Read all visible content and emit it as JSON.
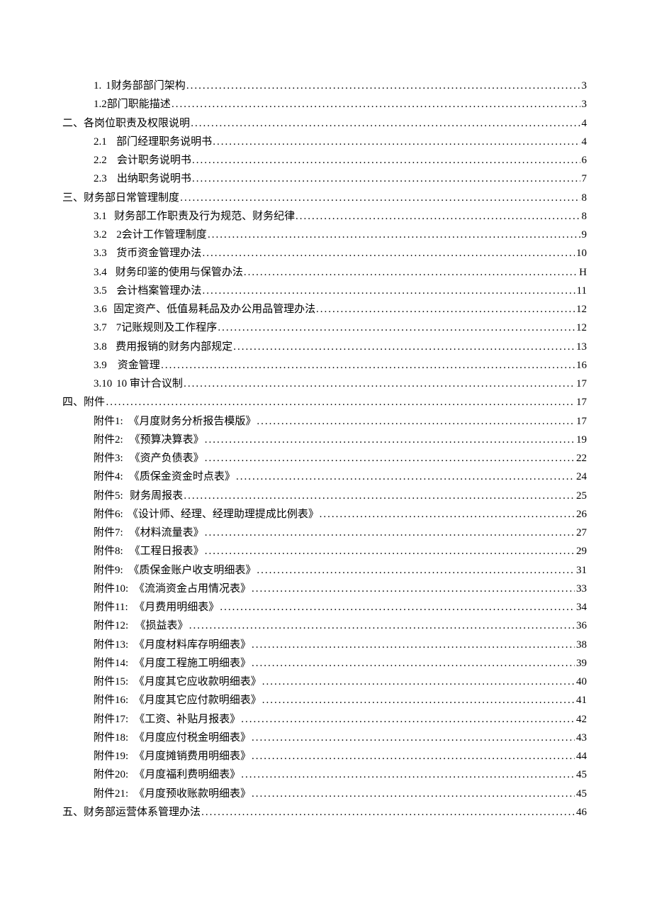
{
  "toc": [
    {
      "indent": "lvl1",
      "num": "1.",
      "gap": "gap-s",
      "title": "1财务部部门架构",
      "page": "3"
    },
    {
      "indent": "lvl1",
      "num": "",
      "gap": "",
      "title": "1.2部门职能描述",
      "page": "3"
    },
    {
      "indent": "lvl0",
      "num": "二、",
      "gap": "",
      "title": "各岗位职责及权限说明",
      "page": "4"
    },
    {
      "indent": "lvl1",
      "num": "2.1",
      "gap": "gap-m",
      "title": "部门经理职务说明书",
      "page": "4"
    },
    {
      "indent": "lvl1",
      "num": "2.2",
      "gap": "gap-m",
      "title": "会计职务说明书",
      "page": "6"
    },
    {
      "indent": "lvl1",
      "num": "2.3",
      "gap": "gap-m",
      "title": "出纳职务说明书",
      "page": "7"
    },
    {
      "indent": "lvl0",
      "num": "三、",
      "gap": "",
      "title": "财务部日常管理制度",
      "page": "8"
    },
    {
      "indent": "lvl1",
      "num": "3.1",
      "gap": "gap-m",
      "title": "财务部工作职责及行为规范、财务纪律",
      "page": "8"
    },
    {
      "indent": "lvl1",
      "num": "3.2",
      "gap": "gap-m",
      "title": "2会计工作管理制度",
      "page": "9"
    },
    {
      "indent": "lvl1",
      "num": "3.3",
      "gap": "gap-m",
      "title": "货币资金管理办法",
      "page": "10"
    },
    {
      "indent": "lvl1",
      "num": "3.4",
      "gap": "gap-m",
      "title": "财务印鉴的使用与保管办法",
      "page": "H"
    },
    {
      "indent": "lvl1",
      "num": "3.5",
      "gap": "gap-m",
      "title": "会计档案管理办法",
      "page": "11"
    },
    {
      "indent": "lvl1",
      "num": "3.6",
      "gap": "gap-m",
      "title": "固定资产、低值易耗品及办公用品管理办法",
      "page": "12"
    },
    {
      "indent": "lvl1",
      "num": "3.7",
      "gap": "gap-m",
      "title": "7记账规则及工作程序",
      "page": "12"
    },
    {
      "indent": "lvl1",
      "num": "3.8",
      "gap": "gap-m",
      "title": "费用报销的财务内部规定",
      "page": "13"
    },
    {
      "indent": "lvl1",
      "num": "3.9",
      "gap": "gap-m",
      "title": "资金管理",
      "page": "16"
    },
    {
      "indent": "lvl1",
      "num": "3.10",
      "gap": "gap-s",
      "title": "10 审计合议制",
      "page": "17"
    },
    {
      "indent": "lvl0",
      "num": "四、",
      "gap": "",
      "title": "附件",
      "page": "17"
    },
    {
      "indent": "lvl1",
      "num": "附件1:",
      "gap": "gap-l",
      "title": "《月度财务分析报告模版》",
      "page": "17"
    },
    {
      "indent": "lvl1",
      "num": "附件2:",
      "gap": "gap-l",
      "title": "《预算决算表》",
      "page": "19"
    },
    {
      "indent": "lvl1",
      "num": "附件3:",
      "gap": "gap-l",
      "title": "《资产负债表》",
      "page": "22"
    },
    {
      "indent": "lvl1",
      "num": "附件4:",
      "gap": "gap-l",
      "title": "《质保金资金时点表》",
      "page": "24"
    },
    {
      "indent": "lvl1",
      "num": "附件5:",
      "gap": "gap-l",
      "title": "财务周报表",
      "page": "25"
    },
    {
      "indent": "lvl1",
      "num": "附件6:",
      "gap": "gap-l",
      "title": "《设计师、经理、经理助理提成比例表》",
      "page": "26"
    },
    {
      "indent": "lvl1",
      "num": "附件7:",
      "gap": "gap-l",
      "title": "《材料流量表》",
      "page": "27"
    },
    {
      "indent": "lvl1",
      "num": "附件8:",
      "gap": "gap-l",
      "title": "《工程日报表》",
      "page": "29"
    },
    {
      "indent": "lvl1",
      "num": "附件9:",
      "gap": "gap-l",
      "title": "《质保金账户收支明细表》",
      "page": "31"
    },
    {
      "indent": "lvl1",
      "num": "附件10:",
      "gap": "gap-l",
      "title": "《流淌资金占用情况表》",
      "page": "33"
    },
    {
      "indent": "lvl1",
      "num": "附件11:",
      "gap": "gap-l",
      "title": "《月费用明细表》",
      "page": "34"
    },
    {
      "indent": "lvl1",
      "num": "附件12:",
      "gap": "gap-l",
      "title": "《损益表》",
      "page": "36"
    },
    {
      "indent": "lvl1",
      "num": "附件13:",
      "gap": "gap-l",
      "title": "《月度材料库存明细表》",
      "page": "38"
    },
    {
      "indent": "lvl1",
      "num": "附件14:",
      "gap": "gap-l",
      "title": "《月度工程施工明细表》",
      "page": "39"
    },
    {
      "indent": "lvl1",
      "num": "附件15:",
      "gap": "gap-l",
      "title": "《月度其它应收款明细表》",
      "page": "40"
    },
    {
      "indent": "lvl1",
      "num": "附件16:",
      "gap": "gap-l",
      "title": "《月度其它应付款明细表》",
      "page": "41"
    },
    {
      "indent": "lvl1",
      "num": "附件17:",
      "gap": "gap-l",
      "title": "《工资、补贴月报表》",
      "page": "42"
    },
    {
      "indent": "lvl1",
      "num": "附件18:",
      "gap": "gap-l",
      "title": "《月度应付税金明细表》",
      "page": "43"
    },
    {
      "indent": "lvl1",
      "num": "附件19:",
      "gap": "gap-l",
      "title": "《月度摊销费用明细表》",
      "page": "44"
    },
    {
      "indent": "lvl1",
      "num": "附件20:",
      "gap": "gap-l",
      "title": "《月度福利费明细表》",
      "page": "45"
    },
    {
      "indent": "lvl1",
      "num": "附件21:",
      "gap": "gap-l",
      "title": "《月度预收账款明细表》",
      "page": "45"
    },
    {
      "indent": "lvl0",
      "num": "五、",
      "gap": "",
      "title": "财务部运营体系管理办法",
      "page": "46"
    }
  ]
}
